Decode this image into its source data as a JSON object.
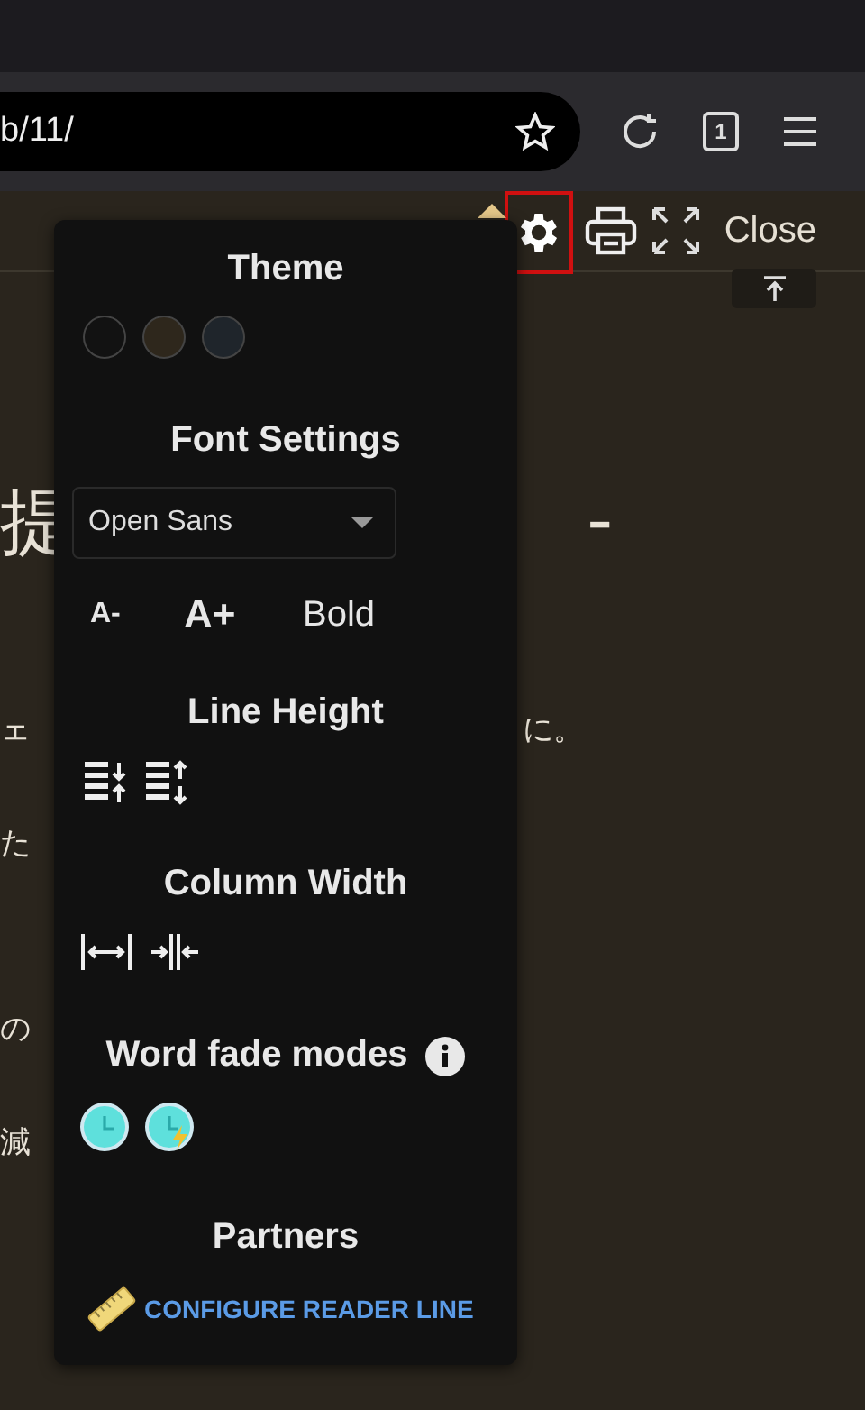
{
  "address_bar": {
    "url": "b/11/"
  },
  "browser_toolbar": {
    "tab_count": "1"
  },
  "reader_toolbar": {
    "close": "Close"
  },
  "article": {
    "lines": [
      {
        "kind": "heading",
        "left": "提",
        "right": "-"
      },
      {
        "kind": "heading"
      },
      {
        "kind": "body",
        "left": "ェ",
        "right": "に。"
      },
      {
        "kind": "body",
        "left": "た"
      },
      {
        "kind": "gap"
      },
      {
        "kind": "body",
        "left": "の"
      },
      {
        "kind": "body",
        "left": "減"
      }
    ]
  },
  "settings_panel": {
    "theme": {
      "title": "Theme",
      "swatches": [
        {
          "color": "#121212"
        },
        {
          "color": "#2e271c"
        },
        {
          "color": "#1f252b"
        }
      ]
    },
    "font": {
      "title": "Font Settings",
      "family": "Open Sans",
      "smaller": "A-",
      "larger": "A+",
      "bold": "Bold"
    },
    "line_height": {
      "title": "Line Height"
    },
    "column_width": {
      "title": "Column Width"
    },
    "word_fade": {
      "title": "Word fade modes",
      "modes": [
        {
          "kind": "clock"
        },
        {
          "kind": "clock-bolt"
        }
      ]
    },
    "partners": {
      "title": "Partners",
      "link": "CONFIGURE READER LINE"
    }
  }
}
